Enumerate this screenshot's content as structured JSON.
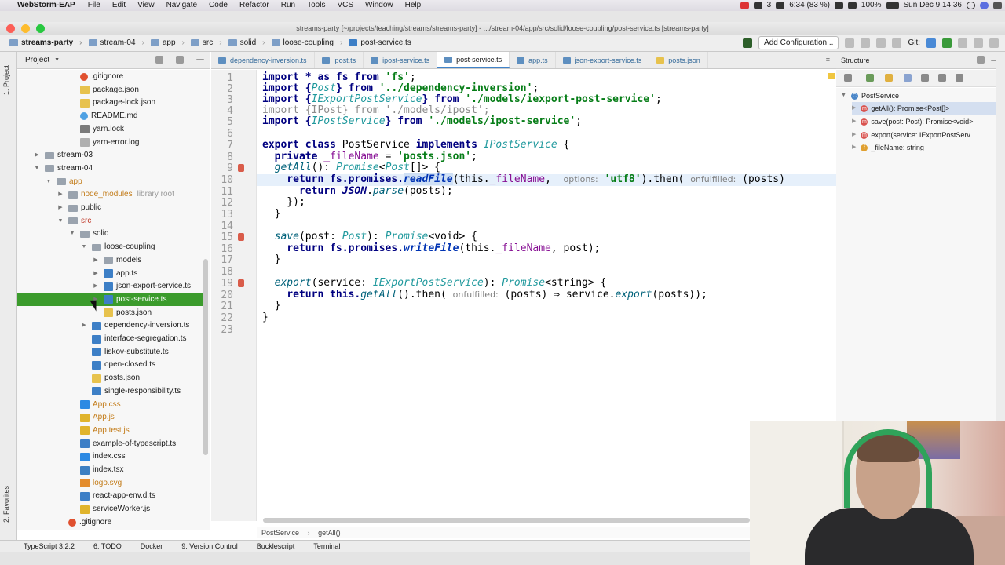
{
  "menubar": {
    "app": "WebStorm-EAP",
    "items": [
      "File",
      "Edit",
      "View",
      "Navigate",
      "Code",
      "Refactor",
      "Run",
      "Tools",
      "VCS",
      "Window",
      "Help"
    ],
    "status": [
      "3",
      "6:34 (83 %)",
      "100%",
      "Sun Dec 9  14:36"
    ]
  },
  "window": {
    "title": "streams-party [~/projects/teaching/streams/streams-party] - .../stream-04/app/src/solid/loose-coupling/post-service.ts [streams-party]"
  },
  "navbar": {
    "crumbs": [
      "streams-party",
      "stream-04",
      "app",
      "src",
      "solid",
      "loose-coupling",
      "post-service.ts"
    ],
    "add_configuration": "Add Configuration...",
    "git_label": "Git:"
  },
  "left_strip": {
    "project": "1: Project",
    "favorites": "2: Favorites"
  },
  "project_panel": {
    "title": "Project",
    "rows": [
      {
        "label": ".gitignore",
        "indent": 4,
        "icon": "git",
        "arrow": "",
        "cls": ""
      },
      {
        "label": "package.json",
        "indent": 4,
        "icon": "json",
        "arrow": "",
        "cls": ""
      },
      {
        "label": "package-lock.json",
        "indent": 4,
        "icon": "json",
        "arrow": "",
        "cls": ""
      },
      {
        "label": "README.md",
        "indent": 4,
        "icon": "md",
        "arrow": "",
        "cls": ""
      },
      {
        "label": "yarn.lock",
        "indent": 4,
        "icon": "lock",
        "arrow": "",
        "cls": ""
      },
      {
        "label": "yarn-error.log",
        "indent": 4,
        "icon": "err",
        "arrow": "",
        "cls": ""
      },
      {
        "label": "stream-03",
        "indent": 1,
        "icon": "folder",
        "arrow": "▶",
        "cls": ""
      },
      {
        "label": "stream-04",
        "indent": 1,
        "icon": "folder",
        "arrow": "▼",
        "cls": ""
      },
      {
        "label": "app",
        "indent": 2,
        "icon": "folder",
        "arrow": "▼",
        "cls": "orange"
      },
      {
        "label": "node_modules",
        "hint": "library root",
        "indent": 3,
        "icon": "folder",
        "arrow": "▶",
        "cls": "orange"
      },
      {
        "label": "public",
        "indent": 3,
        "icon": "folder",
        "arrow": "▶",
        "cls": ""
      },
      {
        "label": "src",
        "indent": 3,
        "icon": "folder",
        "arrow": "▼",
        "cls": "red"
      },
      {
        "label": "solid",
        "indent": 4,
        "icon": "folder",
        "arrow": "▼",
        "cls": ""
      },
      {
        "label": "loose-coupling",
        "indent": 5,
        "icon": "folder",
        "arrow": "▼",
        "cls": ""
      },
      {
        "label": "models",
        "indent": 6,
        "icon": "folder",
        "arrow": "▶",
        "cls": ""
      },
      {
        "label": "app.ts",
        "indent": 6,
        "icon": "ts",
        "arrow": "▶",
        "cls": ""
      },
      {
        "label": "json-export-service.ts",
        "indent": 6,
        "icon": "ts",
        "arrow": "▶",
        "cls": ""
      },
      {
        "label": "post-service.ts",
        "indent": 6,
        "icon": "ts",
        "arrow": "▶",
        "cls": "",
        "selected": true
      },
      {
        "label": "posts.json",
        "indent": 6,
        "icon": "json",
        "arrow": "",
        "cls": ""
      },
      {
        "label": "dependency-inversion.ts",
        "indent": 5,
        "icon": "ts",
        "arrow": "▶",
        "cls": ""
      },
      {
        "label": "interface-segregation.ts",
        "indent": 5,
        "icon": "ts",
        "arrow": "",
        "cls": ""
      },
      {
        "label": "liskov-substitute.ts",
        "indent": 5,
        "icon": "ts",
        "arrow": "",
        "cls": ""
      },
      {
        "label": "open-closed.ts",
        "indent": 5,
        "icon": "ts",
        "arrow": "",
        "cls": ""
      },
      {
        "label": "posts.json",
        "indent": 5,
        "icon": "json",
        "arrow": "",
        "cls": ""
      },
      {
        "label": "single-responsibility.ts",
        "indent": 5,
        "icon": "ts",
        "arrow": "",
        "cls": ""
      },
      {
        "label": "App.css",
        "indent": 4,
        "icon": "css",
        "arrow": "",
        "cls": "orange"
      },
      {
        "label": "App.js",
        "indent": 4,
        "icon": "js",
        "arrow": "",
        "cls": "orange"
      },
      {
        "label": "App.test.js",
        "indent": 4,
        "icon": "js",
        "arrow": "",
        "cls": "orange"
      },
      {
        "label": "example-of-typescript.ts",
        "indent": 4,
        "icon": "ts",
        "arrow": "",
        "cls": ""
      },
      {
        "label": "index.css",
        "indent": 4,
        "icon": "css",
        "arrow": "",
        "cls": ""
      },
      {
        "label": "index.tsx",
        "indent": 4,
        "icon": "tsx",
        "arrow": "",
        "cls": ""
      },
      {
        "label": "logo.svg",
        "indent": 4,
        "icon": "svg",
        "arrow": "",
        "cls": "orange"
      },
      {
        "label": "react-app-env.d.ts",
        "indent": 4,
        "icon": "ts",
        "arrow": "",
        "cls": ""
      },
      {
        "label": "serviceWorker.js",
        "indent": 4,
        "icon": "js",
        "arrow": "",
        "cls": ""
      },
      {
        "label": ".gitignore",
        "indent": 3,
        "icon": "git",
        "arrow": "",
        "cls": ""
      }
    ]
  },
  "tabs": [
    "dependency-inversion.ts",
    "ipost.ts",
    "ipost-service.ts",
    "post-service.ts",
    "app.ts",
    "json-export-service.ts",
    "posts.json"
  ],
  "active_tab": 3,
  "code_lines": [
    "1",
    "2",
    "3",
    "4",
    "5",
    "6",
    "7",
    "8",
    "9",
    "10",
    "11",
    "12",
    "13",
    "14",
    "15",
    "16",
    "17",
    "18",
    "19",
    "20",
    "21",
    "22",
    "23"
  ],
  "code": {
    "l1": [
      "import * as fs from ",
      "'fs'",
      ";"
    ],
    "l2": [
      "import {",
      "Post",
      "} from ",
      "'../dependency-inversion'",
      ";"
    ],
    "l3": [
      "import {",
      "IExportPostService",
      "} from ",
      "'./models/iexport-post-service'",
      ";"
    ],
    "l4": "import {IPost} from './models/ipost';",
    "l5": [
      "import {",
      "IPostService",
      "} from ",
      "'./models/ipost-service'",
      ";"
    ],
    "l7": [
      "export class ",
      "PostService",
      " implements ",
      "IPostService",
      " {"
    ],
    "l8": [
      "  private ",
      "_fileName",
      " = ",
      "'posts.json'",
      ";"
    ],
    "l9": [
      "  ",
      "getAll",
      "(): ",
      "Promise",
      "<",
      "Post",
      "[]> {"
    ],
    "l10": [
      "    return fs.promises.",
      "readFile",
      "(this.",
      "_fileName",
      ",  ",
      "options:",
      " ",
      "'utf8'",
      ").then( ",
      "onfulfilled:",
      " (posts)"
    ],
    "l11": [
      "      return ",
      "JSON",
      ".",
      "parse",
      "(posts);"
    ],
    "l12": "    });",
    "l13": "  }",
    "l15": [
      "  ",
      "save",
      "(post: ",
      "Post",
      "): ",
      "Promise",
      "<void> {"
    ],
    "l16": [
      "    return fs.promises.",
      "writeFile",
      "(this.",
      "_fileName",
      ", post);"
    ],
    "l17": "  }",
    "l19": [
      "  ",
      "export",
      "(service: ",
      "IExportPostService",
      "): ",
      "Promise",
      "<string> {"
    ],
    "l20": [
      "    return this.",
      "getAll",
      "().then( ",
      "onfulfilled:",
      " (posts) ⇒ service.",
      "export",
      "(posts));"
    ],
    "l21": "  }",
    "l22": "}"
  },
  "editor_breadcrumb": [
    "PostService",
    "getAll()"
  ],
  "structure": {
    "title": "Structure",
    "root": "PostService",
    "items": [
      "getAll(): Promise<Post[]>",
      "save(post: Post): Promise<void>",
      "export(service: IExportPostServ",
      "_fileName: string"
    ]
  },
  "bottom_tools": [
    "TypeScript 3.2.2",
    "6: TODO",
    "Docker",
    "9: Version Control",
    "Bucklescript",
    "Terminal"
  ],
  "colors": {
    "selection_green": "#3b9b2c",
    "accent_blue": "#4083c9"
  }
}
